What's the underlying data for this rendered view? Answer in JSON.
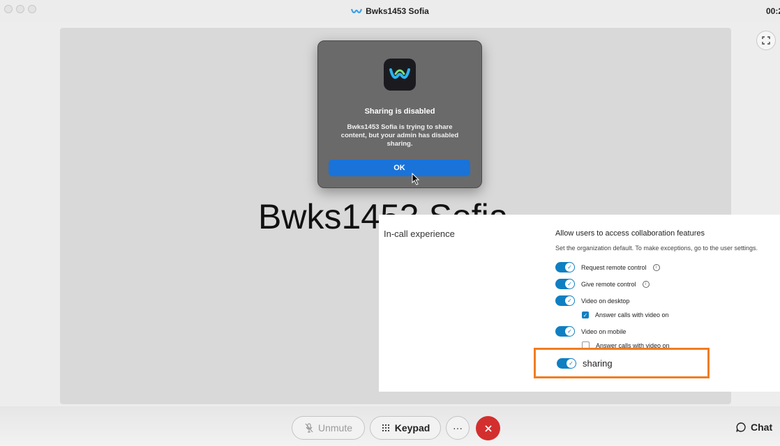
{
  "window": {
    "title": "Bwks1453 Sofia",
    "timer": "00:2"
  },
  "stage": {
    "participant_name": "Bwks1453 Sofia"
  },
  "dialog": {
    "title": "Sharing is disabled",
    "message": "Bwks1453 Sofia is trying to share content, but your admin has disabled sharing.",
    "ok_label": "OK"
  },
  "settings": {
    "section_label": "In-call experience",
    "heading": "Allow users to access collaboration features",
    "subtitle": "Set the organization default. To make exceptions, go to the user settings.",
    "items": [
      {
        "label": "Request remote control",
        "enabled": true
      },
      {
        "label": "Give remote control",
        "enabled": true
      },
      {
        "label": "Video on desktop",
        "enabled": true
      },
      {
        "label": "Answer calls with video on",
        "checked": true
      },
      {
        "label": "Video on mobile",
        "enabled": true
      },
      {
        "label": "Answer calls with video on",
        "checked": false
      },
      {
        "label": "sharing",
        "enabled": true
      }
    ],
    "highlight_color": "#f07d22"
  },
  "controls": {
    "unmute_label": "Unmute",
    "keypad_label": "Keypad",
    "more_label": "···",
    "chat_label": "Chat",
    "end_color": "#d32f2f"
  }
}
